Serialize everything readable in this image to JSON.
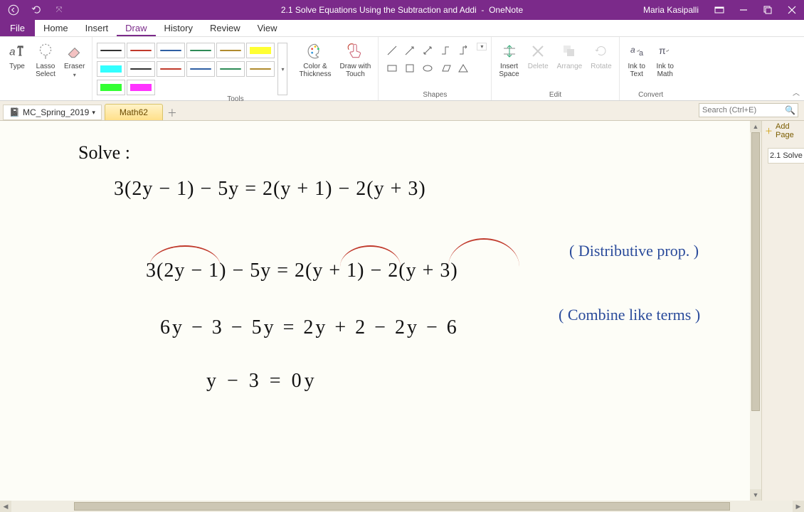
{
  "colors": {
    "accent": "#7b2a8a",
    "ink_black": "#111111",
    "ink_blue": "#2a4b9b",
    "ink_red": "#c0392b"
  },
  "titlebar": {
    "doc_title": "2.1 Solve Equations Using the Subtraction and Addi",
    "app_name": "OneNote",
    "user": "Maria Kasipalli"
  },
  "menu": {
    "file": "File",
    "items": [
      "Home",
      "Insert",
      "Draw",
      "History",
      "Review",
      "View"
    ],
    "active_index": 2
  },
  "ribbon": {
    "type_label": "Type",
    "lasso_label": "Lasso\nSelect",
    "eraser_label": "Eraser",
    "pens": [
      {
        "kind": "pen",
        "color": "#333333"
      },
      {
        "kind": "pen",
        "color": "#c0392b"
      },
      {
        "kind": "pen",
        "color": "#2e5fa3"
      },
      {
        "kind": "pen",
        "color": "#2e8b57"
      },
      {
        "kind": "pen",
        "color": "#b08b2e"
      },
      {
        "kind": "hl",
        "color": "#ffff33"
      },
      {
        "kind": "hl",
        "color": "#33ffff"
      },
      {
        "kind": "pen",
        "color": "#333333"
      },
      {
        "kind": "pen",
        "color": "#c0392b"
      },
      {
        "kind": "pen",
        "color": "#2e5fa3"
      },
      {
        "kind": "pen",
        "color": "#2e8b57"
      },
      {
        "kind": "pen",
        "color": "#b08b2e"
      },
      {
        "kind": "hl",
        "color": "#33ff33"
      },
      {
        "kind": "hl",
        "color": "#ff33ff"
      }
    ],
    "color_thickness": "Color &\nThickness",
    "draw_touch": "Draw with\nTouch",
    "insert_space": "Insert\nSpace",
    "delete": "Delete",
    "arrange": "Arrange",
    "rotate": "Rotate",
    "ink_text": "Ink to\nText",
    "ink_math": "Ink to\nMath",
    "group_tools": "Tools",
    "group_shapes": "Shapes",
    "group_edit": "Edit",
    "group_convert": "Convert"
  },
  "notebook": {
    "name": "MC_Spring_2019",
    "section_tab": "Math62",
    "search_placeholder": "Search (Ctrl+E)",
    "add_page": "Add Page",
    "page_item": "2.1 Solve"
  },
  "handwriting": {
    "heading": "Solve :",
    "line1": "3(2y − 1) − 5y  =  2(y + 1) − 2(y + 3)",
    "line2": "3(2y − 1) − 5y  =  2(y + 1) − 2(y + 3)",
    "note2": "( Distributive prop. )",
    "line3": "6y − 3 − 5y  =  2y + 2 − 2y − 6",
    "note3": "( Combine like terms )",
    "line4": "y − 3   =   0y"
  }
}
